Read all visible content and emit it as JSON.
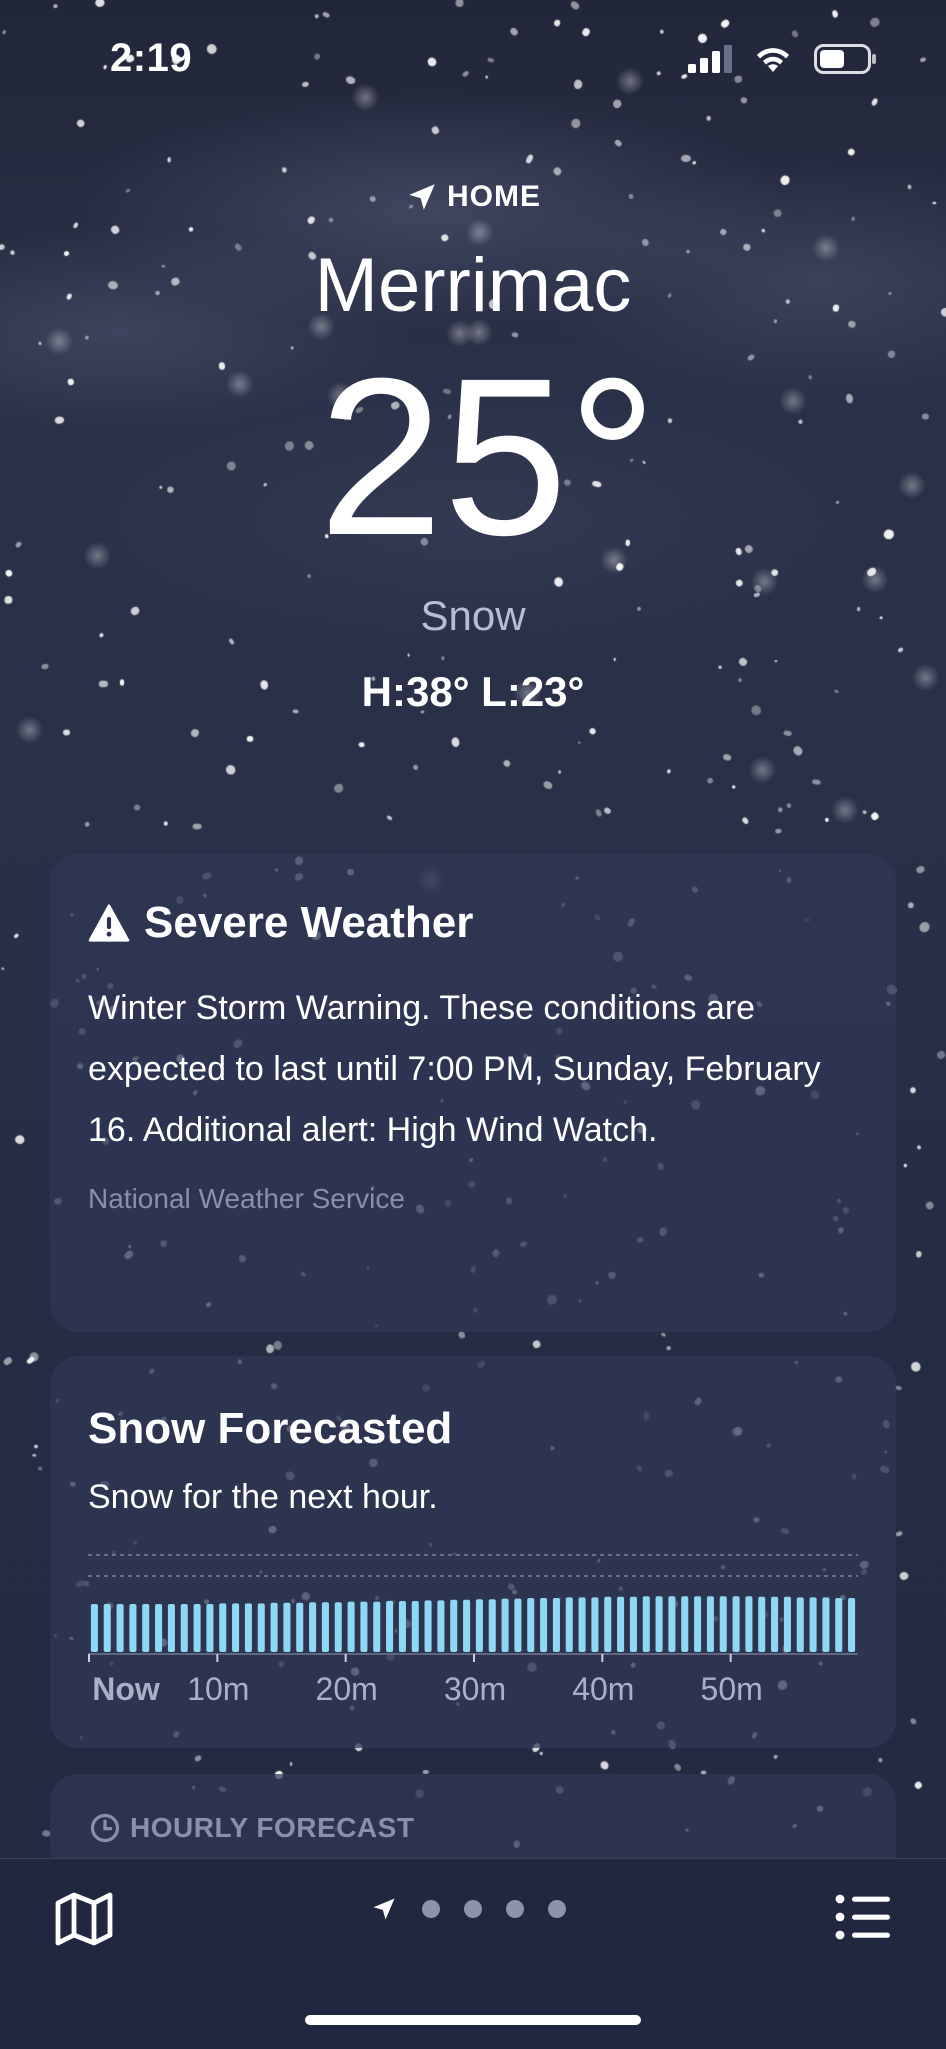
{
  "status_bar": {
    "time": "2:19"
  },
  "location": {
    "label": "HOME",
    "city": "Merrimac"
  },
  "current": {
    "temperature": "25°",
    "condition": "Snow",
    "high_low": "H:38°  L:23°"
  },
  "severe_weather": {
    "title": "Severe Weather",
    "body": "Winter Storm Warning. These conditions are expected to last until 7:00 PM, Sunday, February 16. Additional alert: High Wind Watch.",
    "source": "National Weather Service"
  },
  "snow_forecast": {
    "title": "Snow Forecasted",
    "subtitle": "Snow for the next hour."
  },
  "chart_data": {
    "type": "bar",
    "x_tick_labels": [
      "Now",
      "10m",
      "20m",
      "30m",
      "40m",
      "50m"
    ],
    "values": [
      0.8,
      0.8,
      0.8,
      0.8,
      0.8,
      0.8,
      0.8,
      0.8,
      0.8,
      0.8,
      0.81,
      0.81,
      0.81,
      0.81,
      0.82,
      0.82,
      0.82,
      0.83,
      0.83,
      0.83,
      0.84,
      0.84,
      0.84,
      0.85,
      0.85,
      0.85,
      0.86,
      0.86,
      0.87,
      0.87,
      0.88,
      0.88,
      0.89,
      0.89,
      0.9,
      0.9,
      0.9,
      0.91,
      0.91,
      0.91,
      0.92,
      0.92,
      0.92,
      0.93,
      0.93,
      0.93,
      0.93,
      0.93,
      0.93,
      0.93,
      0.93,
      0.93,
      0.92,
      0.92,
      0.92,
      0.91,
      0.91,
      0.91,
      0.9,
      0.9
    ],
    "ylim": [
      0,
      1
    ],
    "bar_color": "#8fd8f5"
  },
  "hourly": {
    "title": "HOURLY FORECAST"
  },
  "toolbar": {
    "page_count": 4
  }
}
